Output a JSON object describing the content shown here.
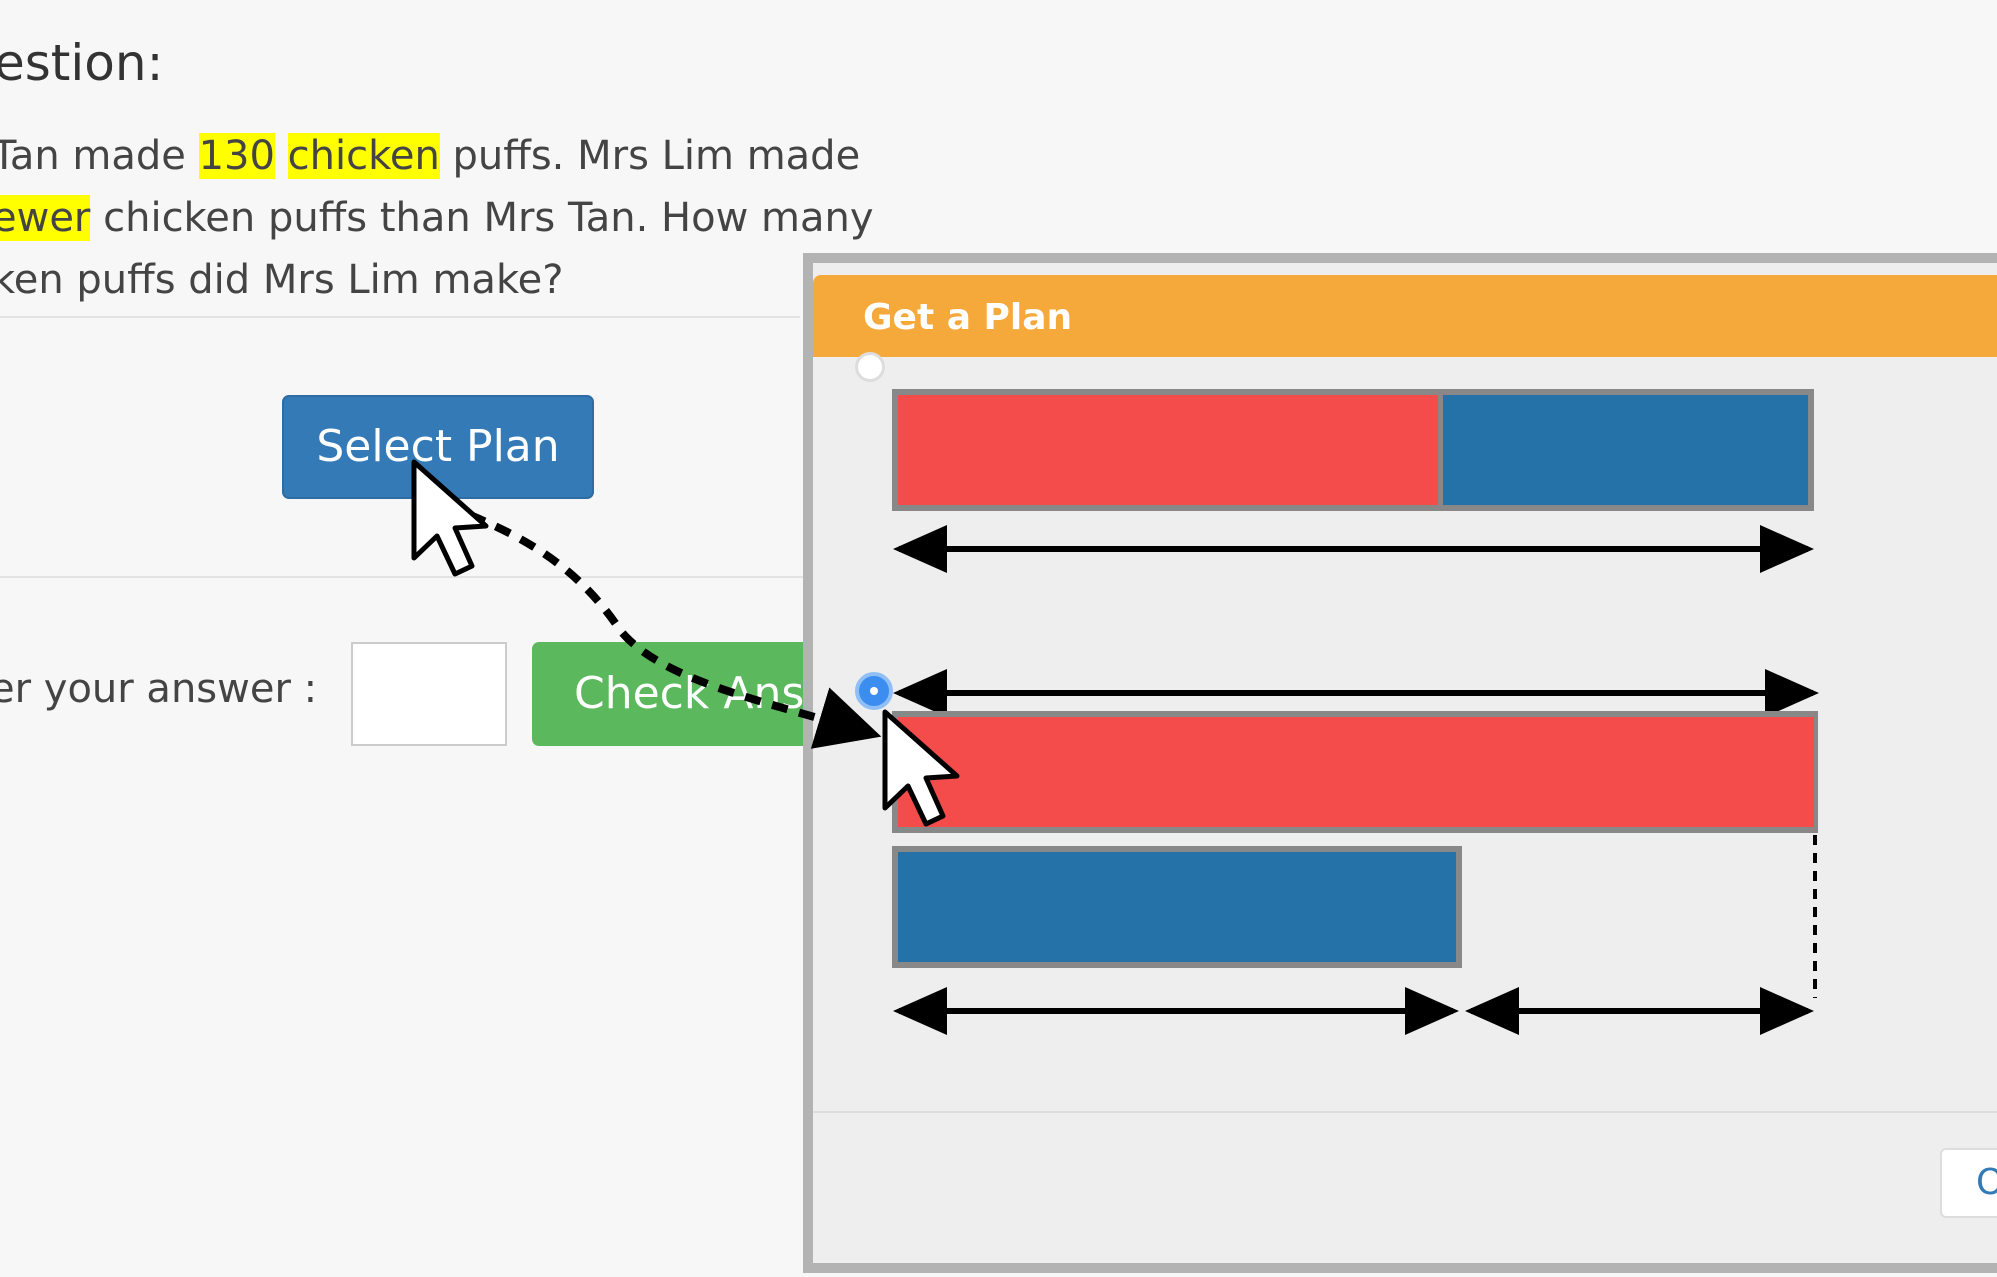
{
  "question": {
    "heading": "estion:",
    "line1": {
      "pre": "Tan made ",
      "number": "130",
      "space": " ",
      "noun": "chicken",
      "post": " puffs. Mrs Lim made"
    },
    "line2": {
      "highlight": "ewer",
      "post": " chicken puffs than Mrs Tan. How many"
    },
    "line3": "ken puffs did Mrs Lim make?"
  },
  "select_plan_label": "Select Plan",
  "answer": {
    "label": "er your answer :",
    "value": "",
    "check_label": "Check Ansv"
  },
  "modal": {
    "title": "Get a Plan",
    "ok_label": "OK",
    "option1": {
      "selected": false,
      "red_fraction": 0.59,
      "blue_fraction": 0.41
    },
    "option2": {
      "selected": true,
      "red_fraction": 1.0,
      "blue_fraction": 0.61
    }
  },
  "colors": {
    "red_bar": "#f44b4b",
    "blue_bar": "#2472a8",
    "header": "#f5a93a",
    "select_button": "#337ab7",
    "check_button": "#5cb85c",
    "highlight": "#ffff00"
  },
  "icons": [
    "mouse-cursor-icon",
    "dashed-path-arrow"
  ]
}
